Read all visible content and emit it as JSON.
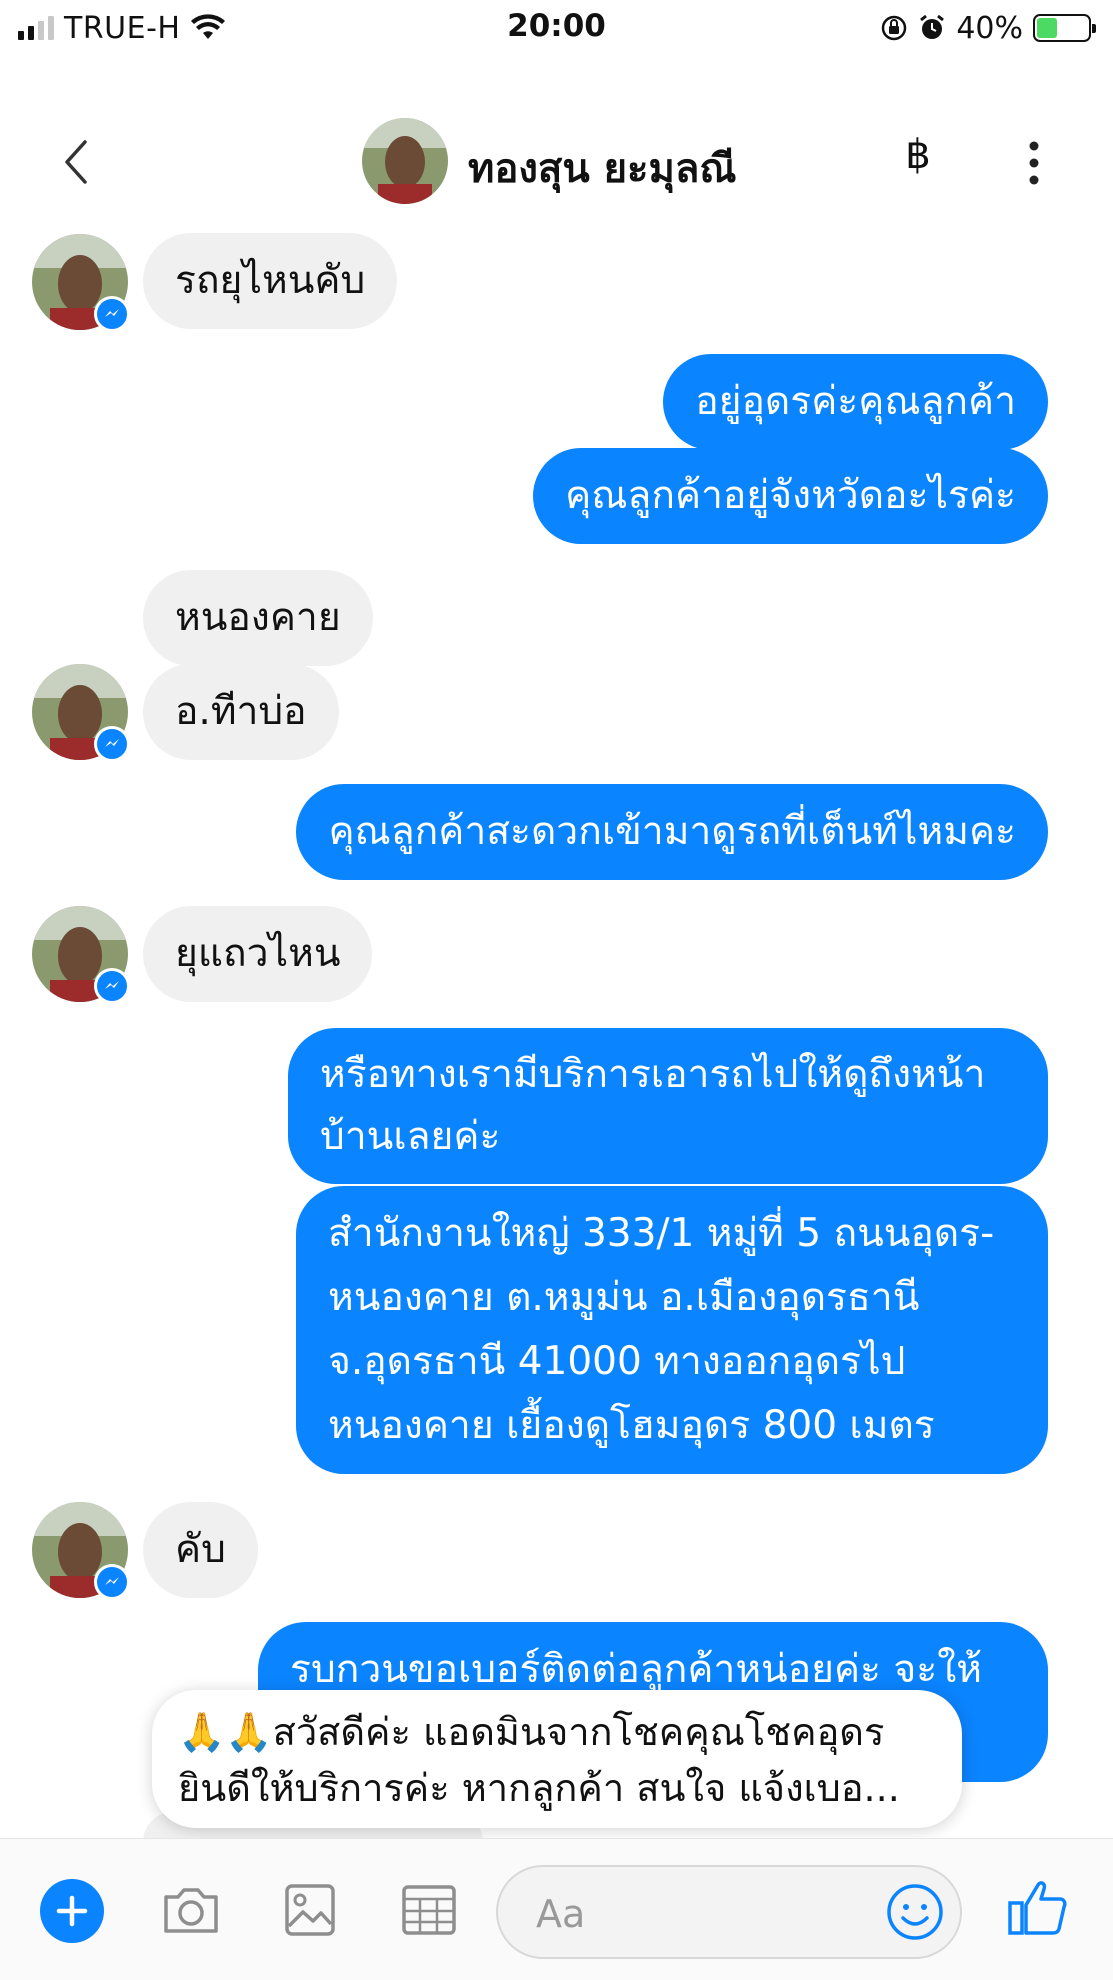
{
  "status_bar": {
    "carrier": "TRUE-H",
    "time": "20:00",
    "battery_percent": "40%",
    "battery_level": 0.4,
    "icons": [
      "signal-icon",
      "wifi-icon",
      "orientation-lock-icon",
      "alarm-icon",
      "battery-charging-icon"
    ]
  },
  "header": {
    "contact_name": "ทองสุน ยะมุลณี",
    "icons": [
      "back-icon",
      "avatar",
      "baht-icon",
      "more-icon"
    ],
    "baht_symbol": "฿"
  },
  "messages": [
    {
      "dir": "in",
      "text": "รถยุไหนคับ"
    },
    {
      "dir": "out",
      "text": "อยู่อุดรค่ะคุณลูกค้า"
    },
    {
      "dir": "out",
      "text": "คุณลูกค้าอยู่จังหวัดอะไรค่ะ"
    },
    {
      "dir": "in",
      "text": "หนองคาย"
    },
    {
      "dir": "in",
      "text": "อ.ทีาบ่อ"
    },
    {
      "dir": "out",
      "text": "คุณลูกค้าสะดวกเข้ามาดูรถที่เต็นท์ไหมคะ"
    },
    {
      "dir": "in",
      "text": "ยุแถวไหน"
    },
    {
      "dir": "out",
      "text": "หรือทางเรามีบริการเอารถไปให้ดูถึงหน้าบ้านเลยค่ะ"
    },
    {
      "dir": "out",
      "text": "สำนักงานใหญ่ 333/1 หมู่ที่ 5 ถนนอุดร-หนองคาย ต.หมูม่น อ.เมืองอุดรธานี จ.อุดรธานี 41000 ทางออกอุดรไปหนองคาย เยื้องดูโฮมอุดร 800 เมตร"
    },
    {
      "dir": "in",
      "text": "คับ"
    },
    {
      "dir": "out",
      "text": "รบกวนขอเบอร์ติดต่อลูกค้าหน่อยค่ะ จะให้"
    }
  ],
  "popup": {
    "line1": "🙏🙏สวัสดีค่ะ แอดมินจากโชคคุณโชคอุดร",
    "line2": "ยินดีให้บริการค่ะ หากลูกค้า สนใจ แจ้งเบอ..."
  },
  "composer": {
    "placeholder": "Aa",
    "icons": [
      "plus-icon",
      "camera-icon",
      "gallery-icon",
      "sticker-icon",
      "emoji-icon",
      "like-icon"
    ]
  },
  "colors": {
    "accent": "#0b84ff",
    "incoming_bubble": "#f0f0f0",
    "battery_fill": "#4cd964"
  }
}
